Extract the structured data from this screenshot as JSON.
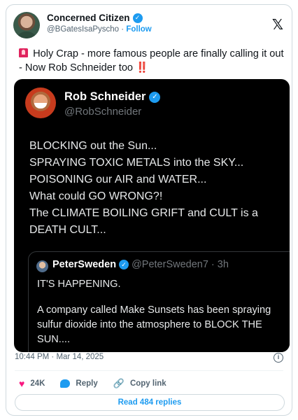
{
  "author": {
    "display_name": "Concerned Citizen",
    "handle": "@BGatesIsaPyscho",
    "separator": "·",
    "follow_label": "Follow"
  },
  "tweet": {
    "text_before": "Holy Crap - more famous people are finally calling it out - Now Rob Schneider too",
    "text_after": "‼️",
    "emoji_start": "siren-icon"
  },
  "quoted": {
    "display_name": "Rob Schneider",
    "handle": "@RobSchneider",
    "lines": [
      "BLOCKING out the Sun...",
      "SPRAYING TOXIC METALS into the SKY...",
      "POISONING our AIR and WATER...",
      "What could GO WRONG?!",
      "The CLIMATE BOILING GRIFT and CULT is a DEATH CULT..."
    ],
    "inner": {
      "display_name": "PeterSweden",
      "handle": "@PeterSweden7",
      "time": "· 3h",
      "para1": "IT'S HAPPENING.",
      "para2": "A company called Make Sunsets has been spraying sulfur dioxide into the atmosphere to BLOCK THE SUN...."
    }
  },
  "meta": {
    "timestamp": "10:44 PM · Mar 14, 2025",
    "info_symbol": "i"
  },
  "actions": {
    "likes": "24K",
    "reply_label": "Reply",
    "copy_label": "Copy link"
  },
  "read_replies_label": "Read 484 replies",
  "colors": {
    "accent": "#1d9bf0",
    "like": "#f91880",
    "text": "#0f1419",
    "muted": "#536471"
  }
}
